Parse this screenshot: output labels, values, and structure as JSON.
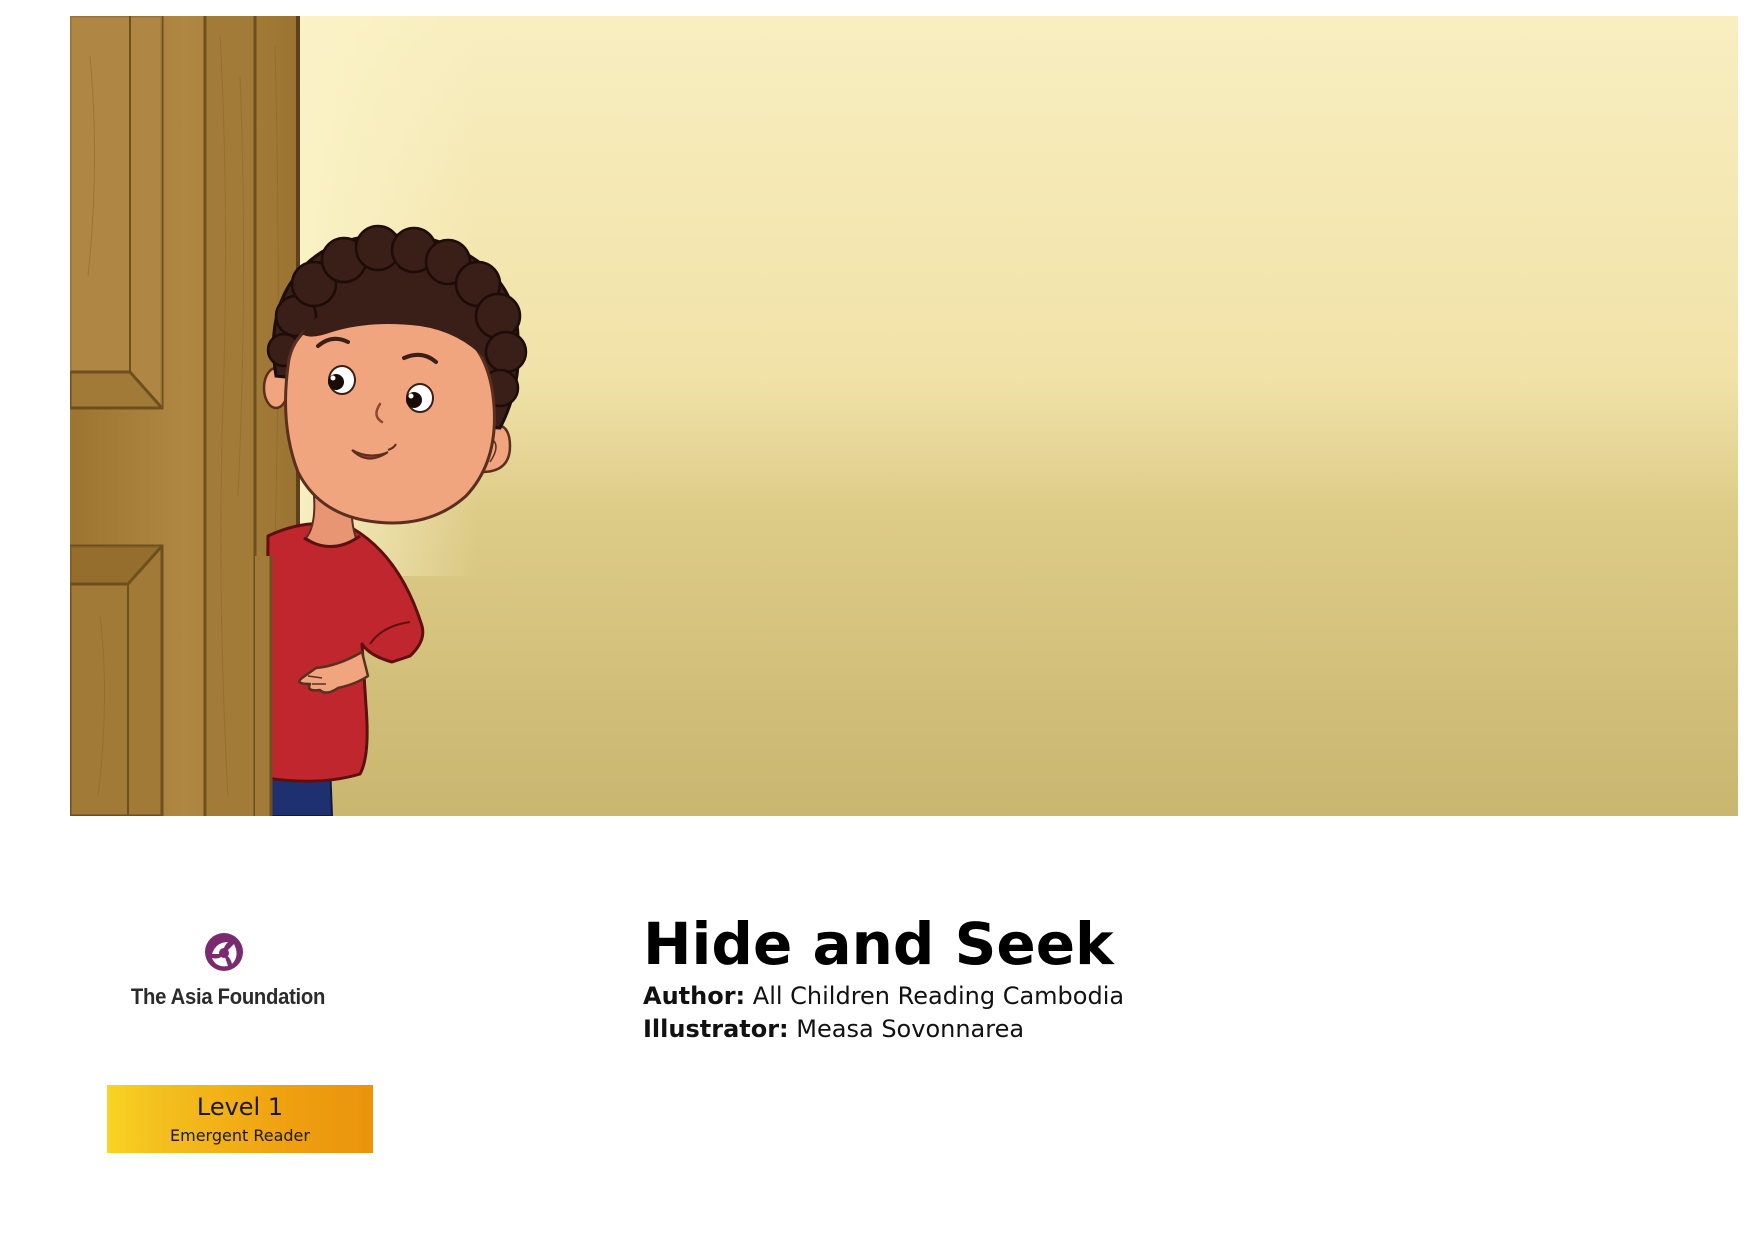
{
  "book": {
    "title": "Hide and Seek",
    "author_label": "Author:",
    "author": "All Children Reading Cambodia",
    "illustrator_label": "Illustrator:",
    "illustrator": "Measa Sovonnarea"
  },
  "publisher": {
    "name": "The Asia Foundation",
    "logo_color": "#7a2a6e"
  },
  "level": {
    "label": "Level 1",
    "subtitle": "Emergent Reader",
    "colors": [
      "#f9d423",
      "#ea930c"
    ]
  },
  "illustration": {
    "subject": "boy-peeking-behind-door",
    "colors": {
      "wall_top": "#f8eec0",
      "wall_bottom": "#c9b66f",
      "door": "#a8803a",
      "shirt": "#c0262d",
      "skin": "#f0a57e",
      "hair": "#3a1f18"
    }
  }
}
